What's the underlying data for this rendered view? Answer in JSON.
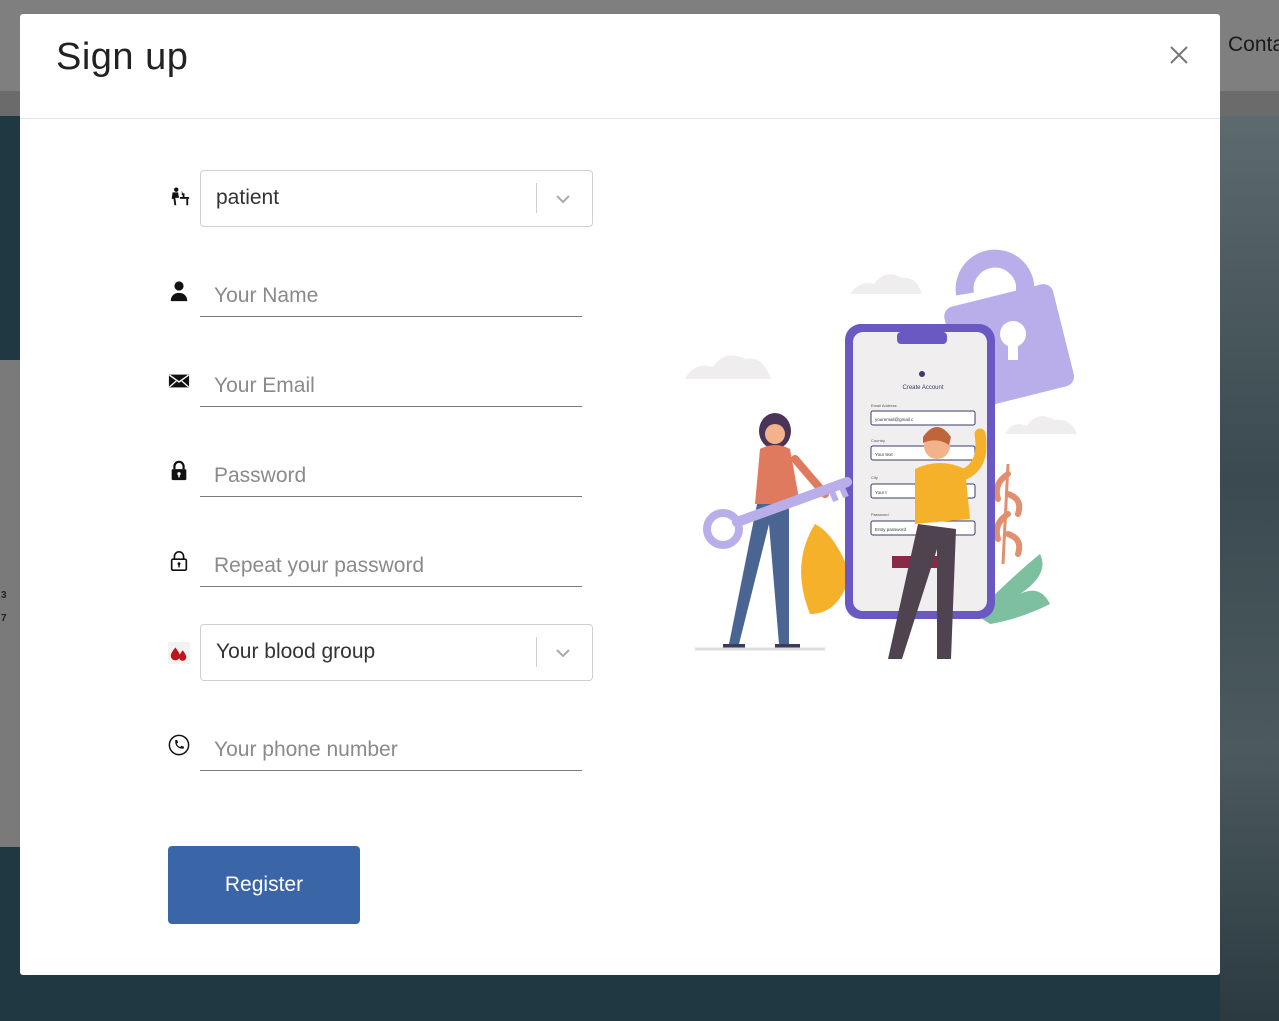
{
  "background": {
    "nav_partial": "Conta",
    "numbers": [
      "3",
      "7"
    ]
  },
  "modal": {
    "title": "Sign up",
    "close_icon": "close-icon",
    "fields": {
      "role_select": {
        "value": "patient",
        "icon": "patient-desk-icon"
      },
      "name": {
        "placeholder": "Your Name",
        "icon": "user-icon"
      },
      "email": {
        "placeholder": "Your Email",
        "icon": "envelope-icon"
      },
      "password": {
        "placeholder": "Password",
        "icon": "lock-icon"
      },
      "repeat_password": {
        "placeholder": "Repeat your password",
        "icon": "lock-outline-icon"
      },
      "blood_group_select": {
        "value": "Your blood group",
        "icon": "blood-drop-icon"
      },
      "phone": {
        "placeholder": "Your phone number",
        "icon": "phone-icon"
      }
    },
    "register_label": "Register",
    "illustration": {
      "heading": "Create Account",
      "field_labels": [
        "Email Address",
        "Country",
        "City",
        "Password"
      ],
      "field_values": [
        "youremail@gmail.c",
        "Your text",
        "Your t",
        "Entry password"
      ]
    }
  },
  "colors": {
    "primary_button": "#3a66a8",
    "overlay": "#1f3841",
    "illustration_purple": "#6a59c2",
    "lock_lavender": "#b9aeea"
  }
}
